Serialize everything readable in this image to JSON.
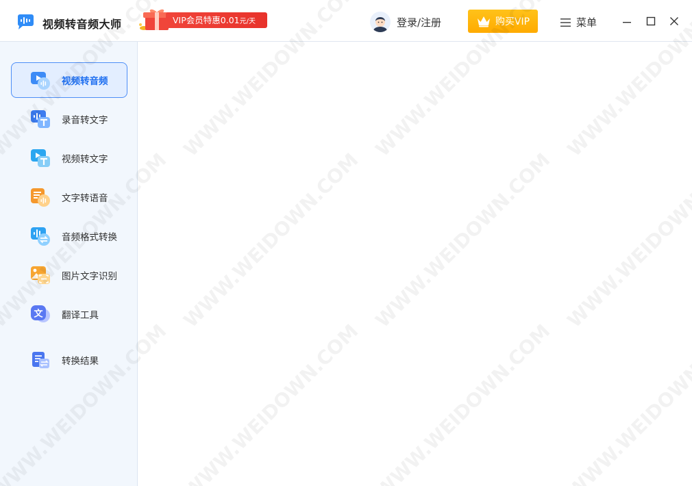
{
  "app": {
    "title": "视频转音频大师",
    "logo_icon": "audio-wave-logo-icon"
  },
  "promo": {
    "text": "VIP会员特惠0.01",
    "unit": "元/天",
    "gift_icon": "gift-box-icon"
  },
  "header": {
    "login_label": "登录/注册",
    "avatar_icon": "user-avatar-icon",
    "vip_label": "购买VIP",
    "vip_icon": "crown-icon",
    "menu_label": "菜单",
    "menu_icon": "hamburger-icon"
  },
  "window_controls": [
    "minimize-icon",
    "maximize-icon",
    "close-icon"
  ],
  "sidebar": {
    "items": [
      {
        "label": "视频转音频",
        "icon": "video-to-audio-icon",
        "active": true
      },
      {
        "label": "录音转文字",
        "icon": "recording-to-text-icon",
        "active": false
      },
      {
        "label": "视频转文字",
        "icon": "video-to-text-icon",
        "active": false
      },
      {
        "label": "文字转语音",
        "icon": "text-to-speech-icon",
        "active": false
      },
      {
        "label": "音频格式转换",
        "icon": "audio-format-convert-icon",
        "active": false
      },
      {
        "label": "图片文字识别",
        "icon": "image-ocr-icon",
        "active": false
      },
      {
        "label": "翻译工具",
        "icon": "translate-icon",
        "active": false
      },
      {
        "label": "转换结果",
        "icon": "conversion-results-icon",
        "active": false
      }
    ]
  },
  "watermark": {
    "text": "WWW.WEIDOWN.COM"
  },
  "colors": {
    "accent": "#1f6ff0",
    "active_bg": "#e3eeff",
    "sidebar_bg": "#f2f7fd",
    "promo_red": "#e8322b",
    "vip_gold": "#ffb000"
  }
}
